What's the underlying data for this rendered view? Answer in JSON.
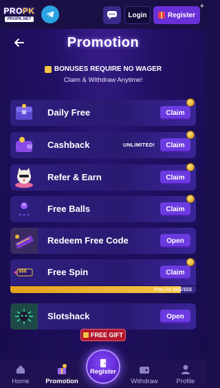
{
  "topbar": {
    "logo_text_a": "PRO",
    "logo_text_b": "PK",
    "logo_sub": "PROPK.NET",
    "login_label": "Login",
    "register_label": "Register"
  },
  "header": {
    "title": "Promotion"
  },
  "notice": {
    "line1": "BONUSES REQUIRE NO WAGER",
    "line2": "Claim & Withdraw Anytime!"
  },
  "promos": [
    {
      "label": "Daily Free",
      "note": "",
      "action": "Claim",
      "thumb_color": "#3a2f9a",
      "badge": true
    },
    {
      "label": "Cashback",
      "note": "UNLIMITED!",
      "action": "Claim",
      "thumb_color": "#3a2f9a",
      "badge": true
    },
    {
      "label": "Refer & Earn",
      "note": "",
      "action": "Claim",
      "thumb_color": "#3a2f9a",
      "badge": true
    },
    {
      "label": "Free Balls",
      "note": "",
      "action": "Claim",
      "thumb_color": "#3a2f9a",
      "badge": true
    },
    {
      "label": "Redeem Free Code",
      "note": "",
      "action": "Open",
      "thumb_color": "#3a2f9a",
      "badge": false
    },
    {
      "label": "Free Spin",
      "note": "",
      "action": "Claim",
      "thumb_color": "#3a2f9a",
      "badge": true,
      "thumb_text": "$$$"
    },
    {
      "label": "Slotshack",
      "note": "",
      "action": "Open",
      "thumb_color": "#1e5a4c",
      "badge": false
    }
  ],
  "free_spin_progress": {
    "text": "Play Rs $$$/$$$",
    "fraction": 0.92
  },
  "free_gift_label": "FREE GIFT",
  "nav": {
    "home": "Home",
    "promotion": "Promotion",
    "register": "Register",
    "withdraw": "Withdraw",
    "profile": "Profile"
  },
  "colors": {
    "accent": "#6b3ae0",
    "background": "#1a0f4a",
    "gold": "#f4c542"
  }
}
